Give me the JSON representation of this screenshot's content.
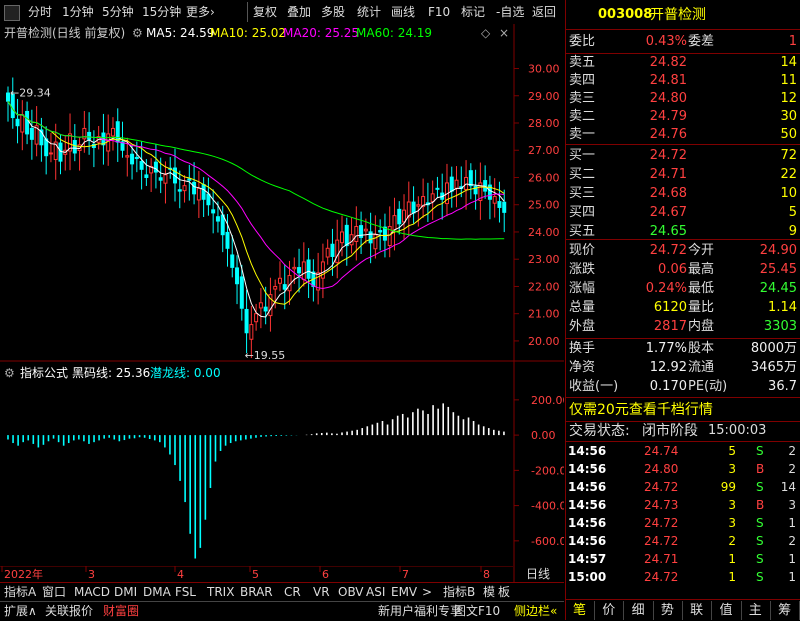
{
  "toolbar": {
    "items": [
      "分时",
      "1分钟",
      "5分钟",
      "15分钟",
      "更多›",
      "复权",
      "叠加",
      "多股",
      "统计",
      "画线",
      "F10",
      "标记",
      "-自选",
      "返回"
    ]
  },
  "chart_header": {
    "title": "开普检测(日线 前复权)",
    "ma5": "MA5: 24.59",
    "ma10": "MA10: 25.02",
    "ma20": "MA20: 25.25",
    "ma60": "MA60: 24.19",
    "colors": {
      "ma5": "#ffffff",
      "ma10": "#ffff00",
      "ma20": "#ff00ff",
      "ma60": "#00ff00"
    }
  },
  "indicator_header": {
    "name": "指标公式",
    "line1": "黑码线: 25.36",
    "line2": "潜龙线: 0.00"
  },
  "chart_data": [
    {
      "type": "candlestick",
      "title": "开普检测(日线 前复权)",
      "ylim": [
        19.3,
        30.9
      ],
      "yticks": [
        20.0,
        21.0,
        22.0,
        23.0,
        24.0,
        25.0,
        26.0,
        27.0,
        28.0,
        29.0,
        30.0
      ],
      "x_axis_labels": [
        "2022年",
        "3",
        "4",
        "5",
        "6",
        "7",
        "8"
      ],
      "annotations": {
        "high": "29.34",
        "low": "19.55",
        "low_marker_1": "财",
        "low_marker_2": "减",
        "low_marker_3": "$"
      },
      "close_approx": [
        28.8,
        28.2,
        27.9,
        28.3,
        27.6,
        27.4,
        27.9,
        27.2,
        26.8,
        26.9,
        27.3,
        26.6,
        27.0,
        27.6,
        26.9,
        27.2,
        27.8,
        27.4,
        27.1,
        27.5,
        27.2,
        27.6,
        27.8,
        27.3,
        27.0,
        26.8,
        26.5,
        26.7,
        26.3,
        26.0,
        26.4,
        26.2,
        25.9,
        26.1,
        26.3,
        25.8,
        25.5,
        25.7,
        25.9,
        25.4,
        25.6,
        25.2,
        25.0,
        24.7,
        24.4,
        23.9,
        23.4,
        22.7,
        22.1,
        21.2,
        20.3,
        20.6,
        21.0,
        21.4,
        21.1,
        21.7,
        22.0,
        22.3,
        21.9,
        22.4,
        22.7,
        22.5,
        22.9,
        22.3,
        22.0,
        22.5,
        22.9,
        23.4,
        23.1,
        23.7,
        24.0,
        23.5,
        23.9,
        24.2,
        23.8,
        24.1,
        23.6,
        23.9,
        24.0,
        23.7,
        24.2,
        24.6,
        24.3,
        24.8,
        25.1,
        24.7,
        25.0,
        25.3,
        25.0,
        25.4,
        25.6,
        25.2,
        25.8,
        25.5,
        25.9,
        25.6,
        26.0,
        25.7,
        25.4,
        25.8,
        25.5,
        25.2,
        25.3,
        24.9,
        24.72
      ],
      "series": [
        {
          "name": "MA5",
          "value": 24.59
        },
        {
          "name": "MA10",
          "value": 25.02
        },
        {
          "name": "MA20",
          "value": 25.25
        },
        {
          "name": "MA60",
          "value": 24.19
        }
      ]
    },
    {
      "type": "bar",
      "title": "指标公式",
      "ylim": [
        -720,
        290
      ],
      "yticks": [
        200.0,
        0.0,
        -200.0,
        -400.0,
        -600.0
      ],
      "series": [
        {
          "name": "黑码线",
          "value": 25.36
        },
        {
          "name": "潜龙线",
          "value": 0.0
        }
      ],
      "values_approx": [
        -25,
        -45,
        -60,
        -40,
        -30,
        -50,
        -70,
        -55,
        -35,
        -20,
        -40,
        -60,
        -45,
        -30,
        -25,
        -35,
        -50,
        -40,
        -30,
        -20,
        -15,
        -25,
        -35,
        -28,
        -20,
        -18,
        -12,
        -15,
        -22,
        -30,
        -40,
        -70,
        -110,
        -170,
        -260,
        -380,
        -560,
        -700,
        -640,
        -480,
        -300,
        -150,
        -90,
        -60,
        -45,
        -35,
        -30,
        -25,
        -20,
        -15,
        -10,
        -8,
        -6,
        -5,
        -4,
        -3,
        -2,
        -1,
        0,
        2,
        5,
        10,
        12,
        14,
        10,
        8,
        15,
        20,
        25,
        30,
        40,
        50,
        60,
        70,
        80,
        60,
        90,
        110,
        120,
        100,
        130,
        150,
        140,
        120,
        170,
        150,
        180,
        160,
        130,
        110,
        90,
        100,
        80,
        60,
        50,
        40,
        30,
        25,
        20
      ],
      "last_value": 25.36
    }
  ],
  "x_axis": {
    "labels": [
      "2022年",
      "3",
      "4",
      "5",
      "6",
      "7",
      "8"
    ],
    "period_label": "日线"
  },
  "bottom_tabs": [
    "指标A",
    "窗口",
    "MACD",
    "DMI",
    "DMA",
    "FSL",
    "TRIX",
    "BRAR",
    "CR",
    "VR",
    "OBV",
    "ASI",
    "EMV",
    ">",
    "指标B",
    "模",
    "板"
  ],
  "bottom_links": [
    "扩展∧",
    "关联报价",
    "财富圈",
    "新用户福利专享",
    "图文F10",
    "侧边栏«"
  ],
  "quote": {
    "code": "003008",
    "name": "开普检测",
    "weibi_label": "委比",
    "weibi": "0.43%",
    "weicha_label": "委差",
    "weicha": "1",
    "asks": [
      {
        "label": "卖五",
        "price": "24.82",
        "vol": "14"
      },
      {
        "label": "卖四",
        "price": "24.81",
        "vol": "11"
      },
      {
        "label": "卖三",
        "price": "24.80",
        "vol": "12"
      },
      {
        "label": "卖二",
        "price": "24.79",
        "vol": "30"
      },
      {
        "label": "卖一",
        "price": "24.76",
        "vol": "50"
      }
    ],
    "bids": [
      {
        "label": "买一",
        "price": "24.72",
        "vol": "72"
      },
      {
        "label": "买二",
        "price": "24.71",
        "vol": "22"
      },
      {
        "label": "买三",
        "price": "24.68",
        "vol": "10"
      },
      {
        "label": "买四",
        "price": "24.67",
        "vol": "5"
      },
      {
        "label": "买五",
        "price": "24.65",
        "vol": "9"
      }
    ],
    "stats": [
      {
        "l1": "现价",
        "v1": "24.72",
        "c1": "red",
        "l2": "今开",
        "v2": "24.90",
        "c2": "red"
      },
      {
        "l1": "涨跌",
        "v1": "0.06",
        "c1": "red",
        "l2": "最高",
        "v2": "25.45",
        "c2": "red"
      },
      {
        "l1": "涨幅",
        "v1": "0.24%",
        "c1": "red",
        "l2": "最低",
        "v2": "24.45",
        "c2": "green"
      },
      {
        "l1": "总量",
        "v1": "6120",
        "c1": "yellow",
        "l2": "量比",
        "v2": "1.14",
        "c2": "yellow"
      },
      {
        "l1": "外盘",
        "v1": "2817",
        "c1": "red",
        "l2": "内盘",
        "v2": "3303",
        "c2": "green"
      }
    ],
    "fund": [
      {
        "l1": "换手",
        "v1": "1.77%",
        "l2": "股本",
        "v2": "8000万"
      },
      {
        "l1": "净资",
        "v1": "12.92",
        "l2": "流通",
        "v2": "3465万"
      },
      {
        "l1": "收益(一)",
        "v1": "0.170",
        "l2": "PE(动)",
        "v2": "36.7"
      }
    ],
    "promo": "仅需20元查看千档行情",
    "trade_state_label": "交易状态:",
    "trade_state": "闭市阶段",
    "trade_time": "15:00:03",
    "ticks": [
      {
        "time": "14:56",
        "price": "24.74",
        "vol": "5",
        "side": "S",
        "n": "2"
      },
      {
        "time": "14:56",
        "price": "24.80",
        "vol": "3",
        "side": "B",
        "n": "2"
      },
      {
        "time": "14:56",
        "price": "24.72",
        "vol": "99",
        "side": "S",
        "n": "14"
      },
      {
        "time": "14:56",
        "price": "24.73",
        "vol": "3",
        "side": "B",
        "n": "3"
      },
      {
        "time": "14:56",
        "price": "24.72",
        "vol": "3",
        "side": "S",
        "n": "1"
      },
      {
        "time": "14:56",
        "price": "24.72",
        "vol": "2",
        "side": "S",
        "n": "2"
      },
      {
        "time": "14:57",
        "price": "24.71",
        "vol": "1",
        "side": "S",
        "n": "1"
      },
      {
        "time": "15:00",
        "price": "24.72",
        "vol": "1",
        "side": "S",
        "n": "1"
      }
    ],
    "tabs": [
      "笔",
      "价",
      "细",
      "势",
      "联",
      "值",
      "主",
      "筹"
    ]
  },
  "colors": {
    "up": "#ff3333",
    "down": "#00ffff",
    "border": "#7f0000",
    "ma5": "#ffffff",
    "ma10": "#ffff00",
    "ma20": "#ff00ff",
    "ma60": "#00ff00"
  }
}
